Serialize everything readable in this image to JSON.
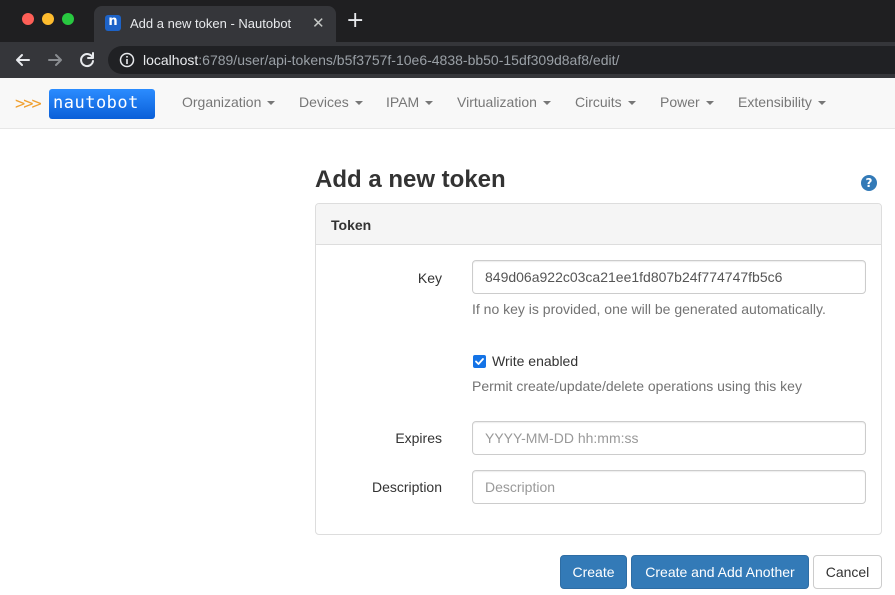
{
  "browser": {
    "tab_title": "Add a new token - Nautobot",
    "tab_favicon": "n",
    "tab_close": "✕",
    "new_tab": "+",
    "url_host": "localhost",
    "url_path": ":6789/user/api-tokens/b5f3757f-10e6-4838-bb50-15df309d8af8/edit/"
  },
  "navbar": {
    "brand_arrows": ">>>",
    "brand": "nautobot",
    "menus": [
      "Organization",
      "Devices",
      "IPAM",
      "Virtualization",
      "Circuits",
      "Power",
      "Extensibility"
    ]
  },
  "page": {
    "title": "Add a new token",
    "help": "?"
  },
  "form": {
    "panel_title": "Token",
    "key": {
      "label": "Key",
      "value": "849d06a922c03ca21ee1fd807b24f774747fb5c6",
      "help": "If no key is provided, one will be generated automatically."
    },
    "write_enabled": {
      "label": "Write enabled",
      "checked": true,
      "help": "Permit create/update/delete operations using this key"
    },
    "expires": {
      "label": "Expires",
      "value": "",
      "placeholder": "YYYY-MM-DD hh:mm:ss"
    },
    "description": {
      "label": "Description",
      "value": "",
      "placeholder": "Description"
    }
  },
  "buttons": {
    "create": "Create",
    "create_another": "Create and Add Another",
    "cancel": "Cancel"
  },
  "colors": {
    "primary": "#337ab7",
    "brand": "#1d72e8",
    "checkbox": "#1473e6"
  }
}
